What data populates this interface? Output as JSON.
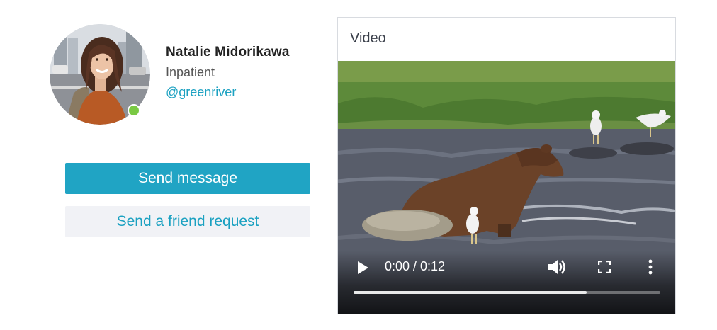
{
  "profile": {
    "name": "Natalie Midorikawa",
    "role": "Inpatient",
    "handle": "@greenriver",
    "status": "online",
    "status_color": "#7ac943",
    "avatar_alt": "Natalie Midorikawa"
  },
  "actions": {
    "send_message_label": "Send message",
    "friend_request_label": "Send a friend request",
    "primary_color": "#20a4c4",
    "secondary_color": "#f1f2f6"
  },
  "video": {
    "title": "Video",
    "current_time": "0:00",
    "duration": "0:12",
    "time_display": "0:00 / 0:12",
    "buffered_fraction": 0.76,
    "icons": {
      "play": "play-icon",
      "volume": "volume-icon",
      "fullscreen": "fullscreen-icon",
      "more": "more-vertical-icon"
    }
  }
}
